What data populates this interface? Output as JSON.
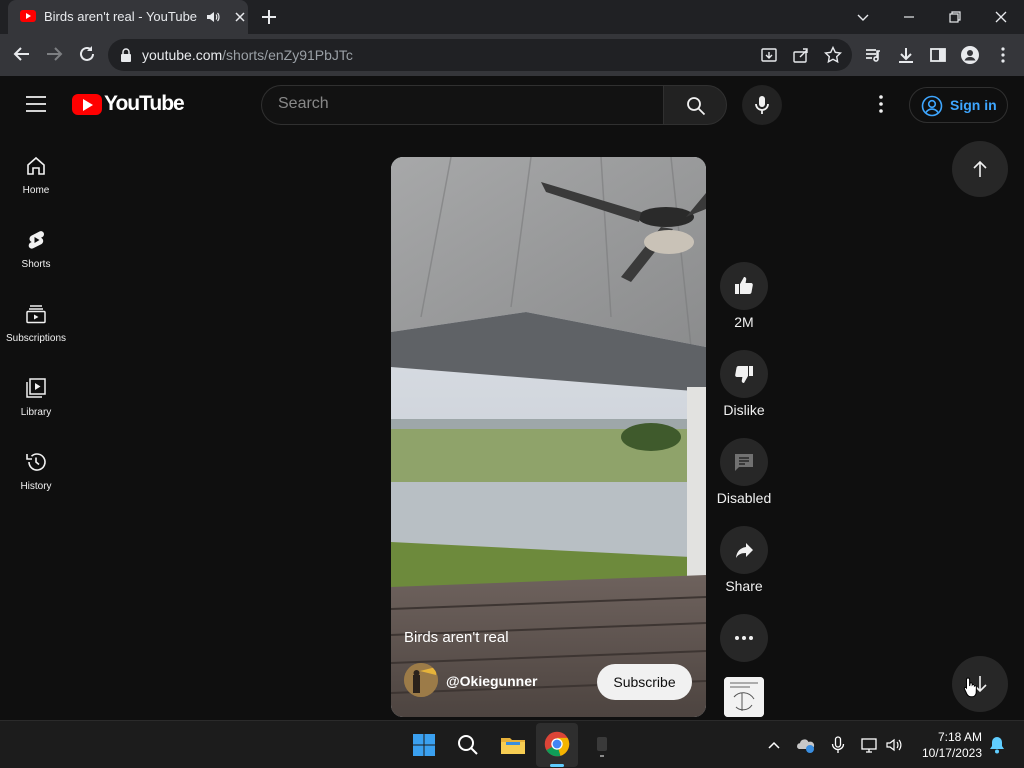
{
  "browser": {
    "tab_title": "Birds aren't real - YouTube",
    "url_host": "youtube.com",
    "url_path": "/shorts/enZy91PbJTc"
  },
  "header": {
    "logo_text": "YouTube",
    "search_placeholder": "Search",
    "sign_in_label": "Sign in"
  },
  "sidebar": {
    "items": [
      {
        "label": "Home",
        "icon": "home-icon"
      },
      {
        "label": "Shorts",
        "icon": "shorts-icon"
      },
      {
        "label": "Subscriptions",
        "icon": "subscriptions-icon"
      },
      {
        "label": "Library",
        "icon": "library-icon"
      },
      {
        "label": "History",
        "icon": "history-icon"
      }
    ]
  },
  "short": {
    "title": "Birds aren't real",
    "channel": "@Okiegunner",
    "subscribe_label": "Subscribe",
    "likes": "2M",
    "dislike_label": "Dislike",
    "comments_label": "Disabled",
    "share_label": "Share"
  },
  "taskbar": {
    "time": "7:18 AM",
    "date": "10/17/2023"
  },
  "colors": {
    "background": "#0f0f0f",
    "accent_red": "#ff0000",
    "link_blue": "#3ea6ff"
  }
}
